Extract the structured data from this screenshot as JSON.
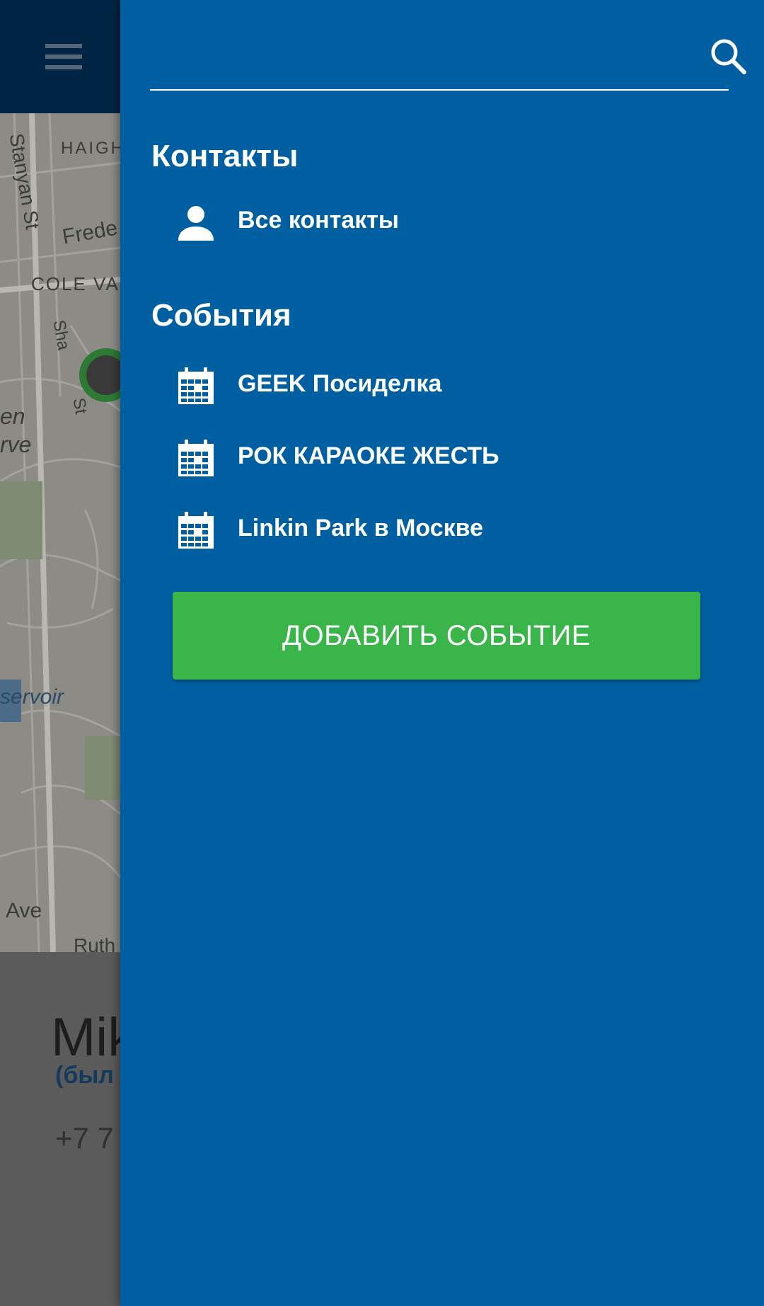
{
  "background": {
    "map_labels": [
      "Stanyan St",
      "HAIGH",
      "Frede",
      "COLE VAL",
      "Sha",
      "St",
      "en",
      "rve",
      "servoir",
      "Ave",
      "Ruth"
    ],
    "contact_name": "Mik",
    "contact_status": "(был",
    "contact_phone": "+7 7"
  },
  "drawer": {
    "search": {
      "placeholder": "",
      "value": ""
    },
    "contacts_section": {
      "title": "Контакты",
      "items": [
        {
          "label": "Все контакты",
          "icon": "person-icon"
        }
      ]
    },
    "events_section": {
      "title": "События",
      "items": [
        {
          "label": "GEEK Посиделка",
          "icon": "calendar-icon"
        },
        {
          "label": "РОК КАРАОКЕ ЖЕСТЬ",
          "icon": "calendar-icon"
        },
        {
          "label": "Linkin Park в Москве",
          "icon": "calendar-icon"
        }
      ]
    },
    "add_event_label": "ДОБАВИТЬ СОБЫТИЕ"
  },
  "colors": {
    "drawer_background": "#005fa1",
    "app_bar": "#002544",
    "add_button": "#39b54a",
    "text": "#ffffff"
  }
}
